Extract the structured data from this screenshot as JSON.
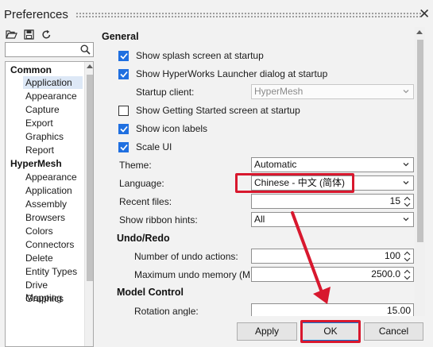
{
  "window": {
    "title": "Preferences",
    "close_glyph": "✕"
  },
  "toolbar": {
    "icons": [
      "folder-open-icon",
      "save-icon",
      "refresh-icon"
    ]
  },
  "search": {
    "placeholder": "",
    "value": ""
  },
  "tree": {
    "groups": [
      {
        "label": "Common",
        "items": [
          "Application",
          "Appearance",
          "Capture",
          "Export",
          "Graphics",
          "Report"
        ]
      },
      {
        "label": "HyperMesh",
        "items": [
          "Appearance",
          "Application",
          "Assembly",
          "Browsers",
          "Colors",
          "Connectors",
          "Delete",
          "Entity Types",
          "Drive Mapping",
          "Graphics"
        ]
      }
    ],
    "selected": "Common/Application"
  },
  "general": {
    "heading": "General",
    "show_splash": {
      "label": "Show splash screen at startup",
      "checked": true
    },
    "show_launcher": {
      "label": "Show HyperWorks Launcher dialog at startup",
      "checked": true
    },
    "startup_client": {
      "label": "Startup client:",
      "value": "HyperMesh"
    },
    "show_getting_started": {
      "label": "Show Getting Started screen at startup",
      "checked": false
    },
    "show_icon_labels": {
      "label": "Show icon labels",
      "checked": true
    },
    "scale_ui": {
      "label": "Scale UI",
      "checked": true
    },
    "theme": {
      "label": "Theme:",
      "value": "Automatic"
    },
    "language": {
      "label": "Language:",
      "value": "Chinese - 中文 (简体)"
    },
    "recent_files": {
      "label": "Recent files:",
      "value": "15"
    },
    "ribbon_hints": {
      "label": "Show ribbon hints:",
      "value": "All"
    }
  },
  "undo_redo": {
    "heading": "Undo/Redo",
    "undo_actions": {
      "label": "Number of undo actions:",
      "value": "100"
    },
    "undo_memory": {
      "label": "Maximum undo memory (MB):",
      "value": "2500.0"
    }
  },
  "model_control": {
    "heading": "Model Control",
    "rotation_angle": {
      "label": "Rotation angle:",
      "value": "15.00"
    }
  },
  "buttons": {
    "apply": "Apply",
    "ok": "OK",
    "cancel": "Cancel"
  },
  "colors": {
    "accent": "#1f6fe0",
    "annotation": "#d8182e"
  }
}
